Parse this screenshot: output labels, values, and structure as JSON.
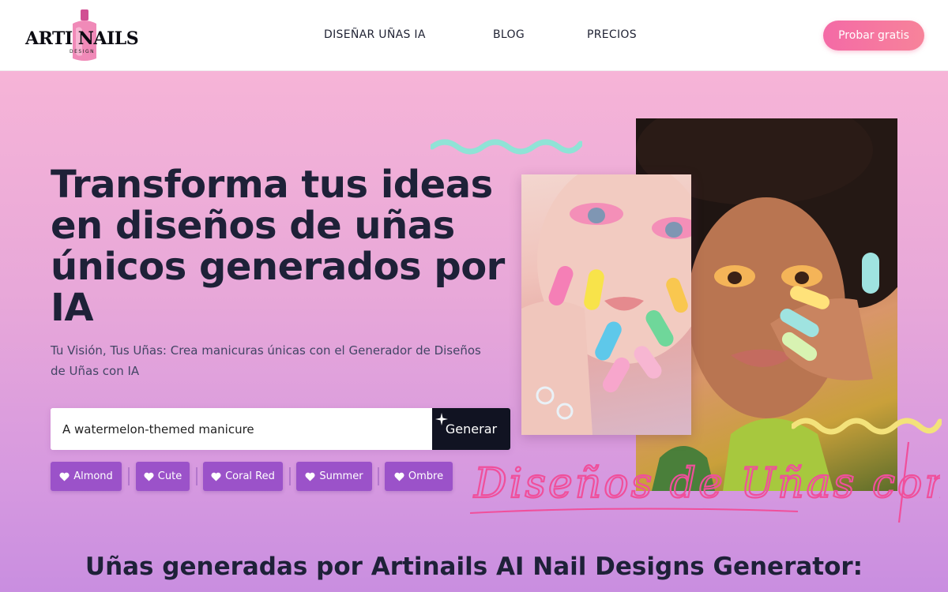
{
  "header": {
    "logo_text": "ARTI NAILS",
    "logo_sub": "DESIGN",
    "nav": [
      "DISEÑAR UÑAS IA",
      "BLOG",
      "PRECIOS"
    ],
    "cta": "Probar gratis"
  },
  "hero": {
    "title": "Transforma tus ideas en diseños de uñas únicos generados por IA",
    "subtitle": "Tu Visión, Tus Uñas: Crea manicuras únicas con el Generador de Diseños de Uñas con IA",
    "prompt_value": "A watermelon-themed manicure",
    "generate_label": "Generar",
    "chips": [
      "Almond",
      "Cute",
      "Coral Red",
      "Summer",
      "Ombre"
    ],
    "script_text": "Diseños de Uñas con IA"
  },
  "section": {
    "title": "Uñas generadas por Artinails AI Nail Designs Generator:"
  },
  "colors": {
    "accent_pink": "#f46aa6",
    "chip_purple": "#9b52c9",
    "button_dark": "#111322",
    "squiggle_teal": "#8fe3d6",
    "squiggle_yellow": "#f3e27a"
  },
  "icons": {
    "chip_icon": "heart-icon",
    "generate_icon": "sparkle-icon"
  }
}
